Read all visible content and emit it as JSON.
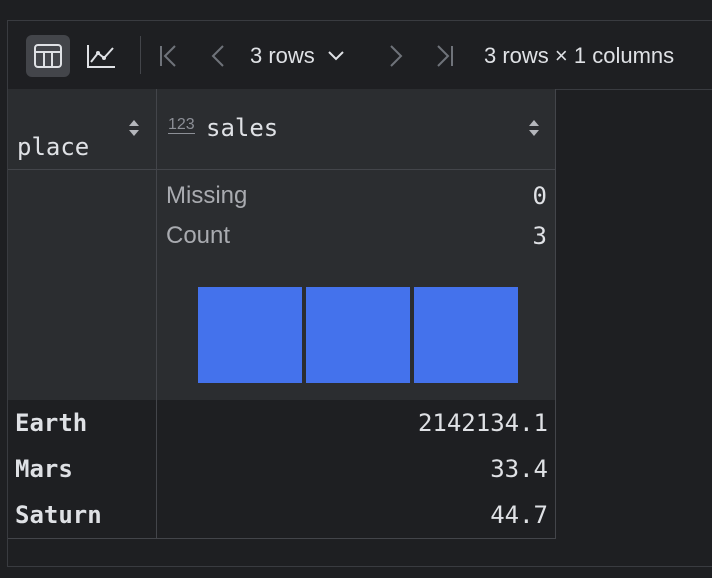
{
  "toolbar": {
    "table_view_icon": "table-grid-icon",
    "chart_view_icon": "line-chart-icon",
    "rows_selector": "3 rows",
    "summary": "3 rows × 1 columns"
  },
  "columns": [
    {
      "name": "place",
      "type_badge": ""
    },
    {
      "name": "sales",
      "type_badge": "123"
    }
  ],
  "stats": {
    "missing_label": "Missing",
    "missing_value": "0",
    "count_label": "Count",
    "count_value": "3",
    "histogram_color": "#4472ec",
    "histogram_bins": [
      1,
      1,
      1
    ]
  },
  "rows": [
    {
      "place": "Earth",
      "sales": "2142134.1"
    },
    {
      "place": "Mars",
      "sales": "33.4"
    },
    {
      "place": "Saturn",
      "sales": "44.7"
    }
  ],
  "colors": {
    "background": "#1e1f22",
    "panel": "#2b2d30",
    "border": "#43454a",
    "text": "#dfe1e5",
    "muted": "#8c8f96"
  }
}
